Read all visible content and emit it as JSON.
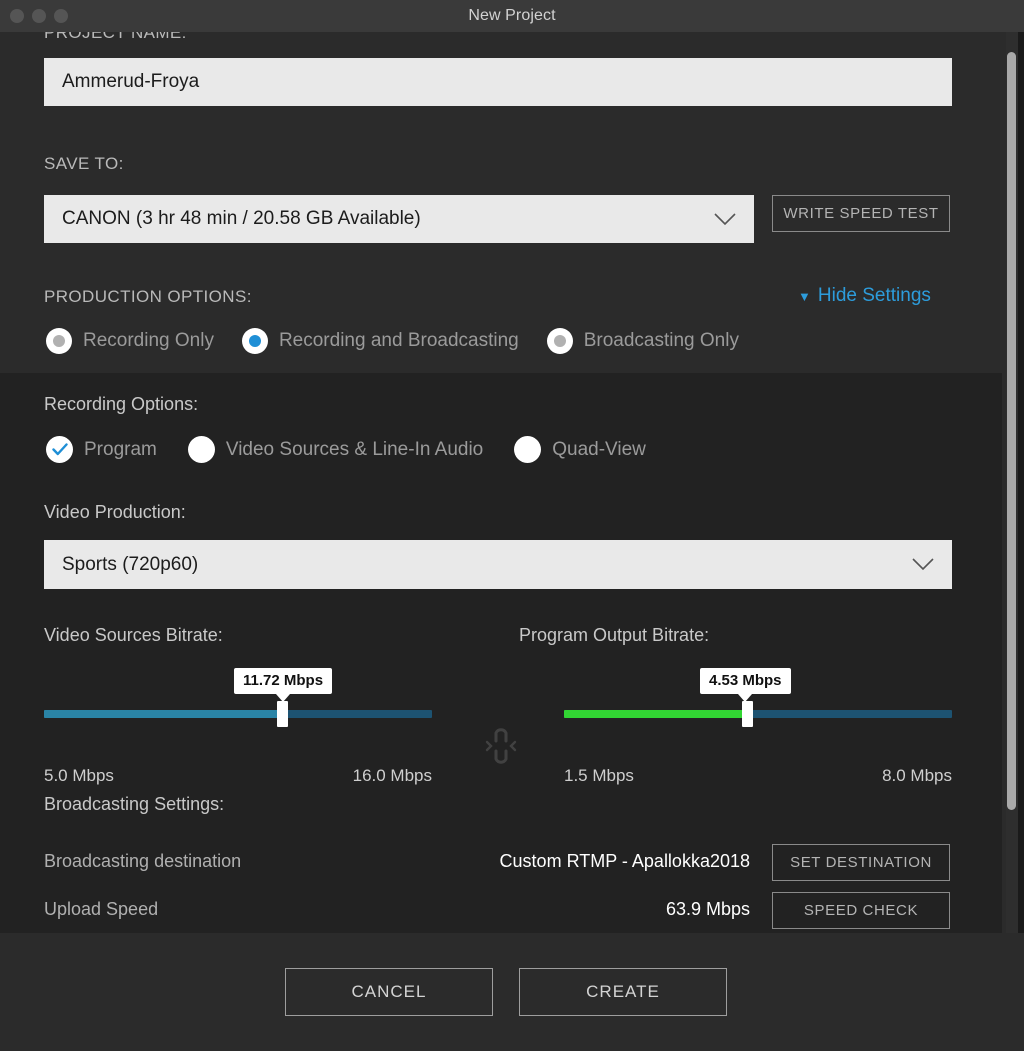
{
  "window": {
    "title": "New Project",
    "traffic_lights": [
      "close",
      "minimize",
      "zoom"
    ]
  },
  "project_name": {
    "label": "PROJECT NAME:",
    "value": "Ammerud-Froya"
  },
  "save_to": {
    "label": "SAVE TO:",
    "selected": "CANON (3 hr 48 min / 20.58 GB Available)",
    "write_speed_test": "WRITE SPEED TEST"
  },
  "production_options": {
    "label": "PRODUCTION OPTIONS:",
    "hide_settings": "Hide Settings",
    "hide_settings_arrow": "▼",
    "options": [
      {
        "label": "Recording Only",
        "selected": false
      },
      {
        "label": "Recording and Broadcasting",
        "selected": true
      },
      {
        "label": "Broadcasting Only",
        "selected": false
      }
    ]
  },
  "recording_options": {
    "label": "Recording Options:",
    "options": [
      {
        "label": "Program",
        "checked": true
      },
      {
        "label": "Video Sources & Line-In Audio",
        "checked": false
      },
      {
        "label": "Quad-View",
        "checked": false
      }
    ]
  },
  "video_production": {
    "label": "Video Production:",
    "selected": "Sports (720p60)"
  },
  "bitrate": {
    "link_icon": "broken-link-icon",
    "video_sources": {
      "label": "Video Sources Bitrate:",
      "value_text": "11.72 Mbps",
      "value": 11.72,
      "min_text": "5.0 Mbps",
      "max_text": "16.0 Mbps",
      "min": 5.0,
      "max": 16.0,
      "fill_color": "#2a84a6"
    },
    "program_output": {
      "label": "Program Output Bitrate:",
      "value_text": "4.53 Mbps",
      "value": 4.53,
      "min_text": "1.5 Mbps",
      "max_text": "8.0 Mbps",
      "min": 1.5,
      "max": 8.0,
      "fill_color": "#32d533"
    }
  },
  "broadcasting": {
    "label": "Broadcasting Settings:",
    "rows": [
      {
        "label": "Broadcasting destination",
        "value": "Custom RTMP - Apallokka2018",
        "button": "SET DESTINATION"
      },
      {
        "label": "Upload Speed",
        "value": "63.9 Mbps",
        "button": "SPEED CHECK"
      }
    ]
  },
  "footer": {
    "cancel": "CANCEL",
    "create": "CREATE"
  }
}
